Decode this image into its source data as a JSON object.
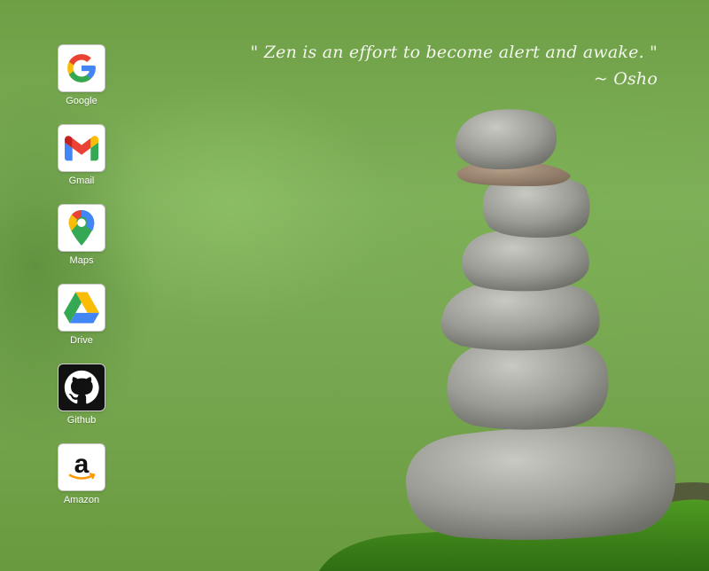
{
  "quote": {
    "text": "\" Zen is an effort to become alert and awake. \"",
    "author": "~ Osho"
  },
  "apps": [
    {
      "label": "Google",
      "icon": "google-icon"
    },
    {
      "label": "Gmail",
      "icon": "gmail-icon"
    },
    {
      "label": "Maps",
      "icon": "maps-icon"
    },
    {
      "label": "Drive",
      "icon": "drive-icon"
    },
    {
      "label": "Github",
      "icon": "github-icon"
    },
    {
      "label": "Amazon",
      "icon": "amazon-icon"
    }
  ],
  "colors": {
    "google_blue": "#4285F4",
    "google_red": "#EA4335",
    "google_yellow": "#FBBC05",
    "google_green": "#34A853",
    "amazon_orange": "#FF9900"
  }
}
